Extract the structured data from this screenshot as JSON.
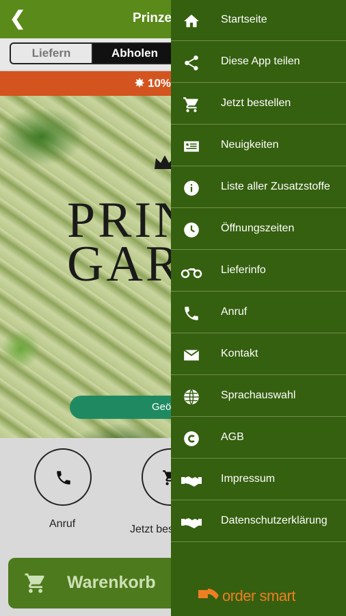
{
  "header": {
    "title": "Prinzengarten"
  },
  "order_mode": {
    "tabs": [
      "Liefern",
      "Abholen"
    ],
    "selected": "Abholen"
  },
  "promo": {
    "text": "10%"
  },
  "hero": {
    "logo_text_line1": "PRINZEN",
    "logo_text_line2": "GARTEN"
  },
  "status": {
    "text": "Geöffnet"
  },
  "actions": {
    "call_label": "Anruf",
    "order_label": "Jetzt bestellen"
  },
  "cart": {
    "label": "Warenkorb"
  },
  "menu": {
    "items": [
      {
        "label": "Startseite",
        "icon": "home-icon"
      },
      {
        "label": "Diese App teilen",
        "icon": "share-icon"
      },
      {
        "label": "Jetzt bestellen",
        "icon": "cart-icon"
      },
      {
        "label": "Neuigkeiten",
        "icon": "news-icon"
      },
      {
        "label": "Liste aller Zusatzstoffe",
        "icon": "info-icon"
      },
      {
        "label": "Öffnungszeiten",
        "icon": "clock-icon"
      },
      {
        "label": "Lieferinfo",
        "icon": "motorbike-icon"
      },
      {
        "label": "Anruf",
        "icon": "phone-icon"
      },
      {
        "label": "Kontakt",
        "icon": "mail-icon"
      },
      {
        "label": "Sprachauswahl",
        "icon": "globe-icon"
      },
      {
        "label": "AGB",
        "icon": "copyright-icon"
      },
      {
        "label": "Impressum",
        "icon": "handshake-icon"
      },
      {
        "label": "Datenschutzerklärung",
        "icon": "handshake-icon"
      }
    ]
  },
  "brand": {
    "name": "order smart"
  },
  "colors": {
    "primary_green": "#35600f",
    "topbar_green": "#5a8a1a",
    "promo_orange": "#d4541f",
    "brand_orange": "#ef7e22"
  }
}
